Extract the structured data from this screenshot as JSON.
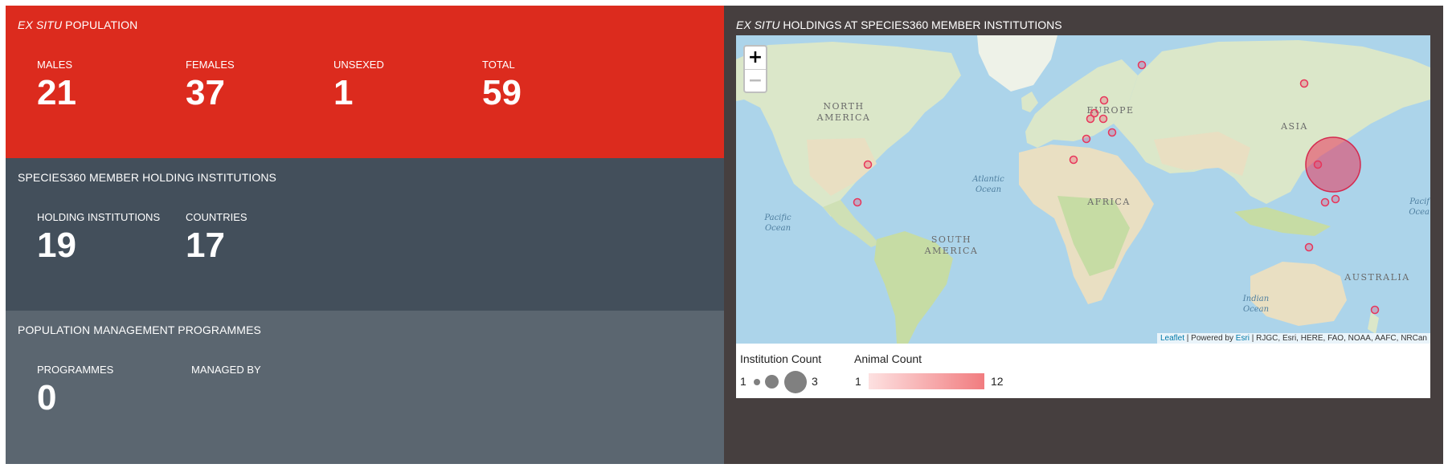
{
  "population": {
    "title_italic": "EX SITU",
    "title_rest": " POPULATION",
    "stats": [
      {
        "label": "MALES",
        "value": "21"
      },
      {
        "label": "FEMALES",
        "value": "37"
      },
      {
        "label": "UNSEXED",
        "value": "1"
      },
      {
        "label": "TOTAL",
        "value": "59"
      }
    ],
    "color": "#dc2b1e"
  },
  "institutions": {
    "title": "SPECIES360 MEMBER HOLDING INSTITUTIONS",
    "stats": [
      {
        "label": "HOLDING INSTITUTIONS",
        "value": "19"
      },
      {
        "label": "COUNTRIES",
        "value": "17"
      }
    ]
  },
  "programmes": {
    "title": "POPULATION MANAGEMENT PROGRAMMES",
    "stats": [
      {
        "label": "PROGRAMMES",
        "value": "0"
      },
      {
        "label": "MANAGED BY",
        "value": ""
      }
    ]
  },
  "map_panel": {
    "title_italic": "EX SITU",
    "title_rest": " HOLDINGS AT SPECIES360 MEMBER INSTITUTIONS",
    "zoom_in": "+",
    "zoom_out": "−",
    "attribution": {
      "leaflet": "Leaflet",
      "powered": " | Powered by ",
      "esri": "Esri",
      "rest": " | RJGC, Esri, HERE, FAO, NOAA, AAFC, NRCan"
    },
    "labels": {
      "north_america_1": "NORTH",
      "north_america_2": "AMERICA",
      "europe": "EUROPE",
      "asia": "ASIA",
      "africa": "AFRICA",
      "south_america_1": "SOUTH",
      "south_america_2": "AMERICA",
      "australia": "AUSTRALIA",
      "atlantic_1": "Atlantic",
      "atlantic_2": "Ocean",
      "pacific_1": "Pacific",
      "pacific_2": "Ocean",
      "pacific_east_1": "Pacif",
      "pacific_east_2": "Ocea",
      "indian_1": "Indian",
      "indian_2": "Ocean"
    },
    "legend": {
      "institution_title": "Institution Count",
      "institution_min": "1",
      "institution_max": "3",
      "animal_title": "Animal Count",
      "animal_min": "1",
      "animal_max": "12",
      "marker_color": "#e8355a"
    }
  }
}
